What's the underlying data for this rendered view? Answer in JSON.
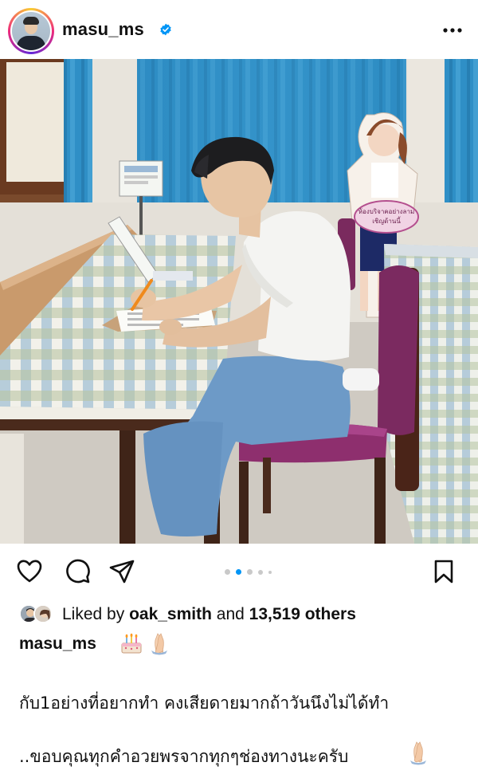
{
  "post": {
    "username": "masu_ms",
    "verified": true,
    "more_icon": "more-horizontal-icon"
  },
  "actions": {
    "like_icon": "heart-icon",
    "comment_icon": "comment-icon",
    "share_icon": "send-icon",
    "save_icon": "bookmark-icon",
    "carousel": {
      "count": 5,
      "active_index": 1
    }
  },
  "likes": {
    "prefix": "Liked by ",
    "user": "oak_smith",
    "middle": " and ",
    "count": "13,519 others"
  },
  "caption": {
    "username": "masu_ms",
    "line1": "กับ1อย่างที่อยากทำ คงเสียดายมากถ้าวันนึงไม่ได้ทำ",
    "line2": "..ขอบคุณทุกคำอวยพรจากทุกๆช่องทางนะครับ"
  },
  "photo": {
    "sign_text_1": "ห้องบริจาคอย่างลาม",
    "sign_text_2": "เชิญด้านนี้"
  },
  "colors": {
    "accent_blue": "#0095f6",
    "text": "#111111",
    "curtain": "#2e8fc4",
    "chair_seat": "#8e2f6e"
  }
}
